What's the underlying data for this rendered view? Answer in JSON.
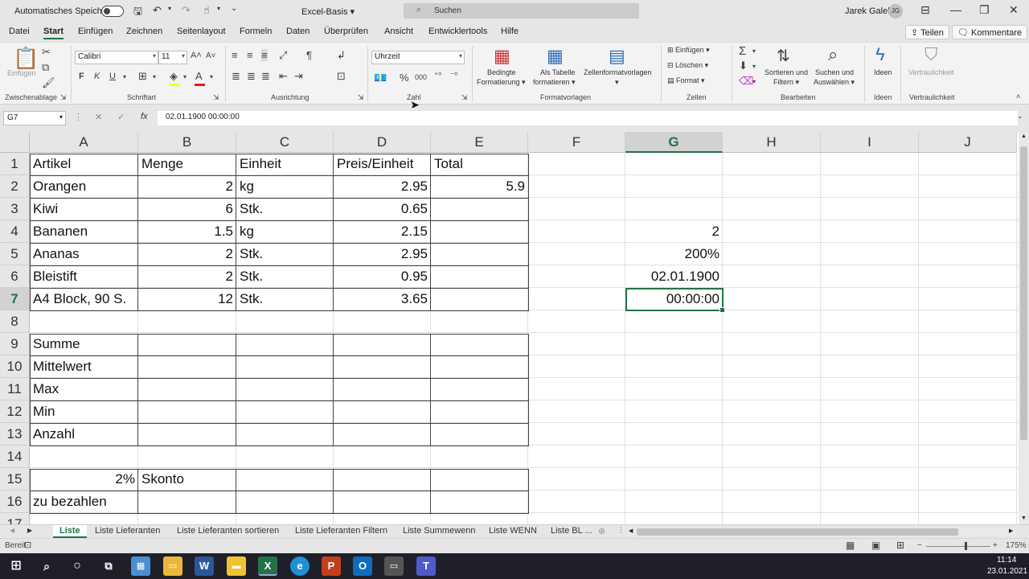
{
  "titlebar": {
    "autosave_label": "Automatisches Speichern",
    "file_name": "Excel-Basis",
    "search_placeholder": "Suchen",
    "user_name": "Jarek Galek",
    "user_initials": "JG"
  },
  "tabs": [
    "Datei",
    "Start",
    "Einfügen",
    "Zeichnen",
    "Seitenlayout",
    "Formeln",
    "Daten",
    "Überprüfen",
    "Ansicht",
    "Entwicklertools",
    "Hilfe"
  ],
  "active_tab": "Start",
  "share_label": "Teilen",
  "comments_label": "Kommentare",
  "ribbon": {
    "clipboard": {
      "paste_label": "Einfügen",
      "group": "Zwischenablage"
    },
    "font": {
      "name": "Calibri",
      "size": "11",
      "bold": "F",
      "italic": "K",
      "underline": "U",
      "group": "Schriftart"
    },
    "alignment": {
      "group": "Ausrichtung"
    },
    "number": {
      "format": "Uhrzeit",
      "percent": "%",
      "thousands": "000",
      "group": "Zahl"
    },
    "styles": {
      "conditional": "Bedingte",
      "conditional2": "Formatierung",
      "as_table": "Als Tabelle",
      "as_table2": "formatieren",
      "cell_styles": "Zellenformatvorlagen",
      "group": "Formatvorlagen"
    },
    "cells": {
      "insert": "Einfügen",
      "delete": "Löschen",
      "format": "Format",
      "group": "Zellen"
    },
    "editing": {
      "sort": "Sortieren und",
      "sort2": "Filtern",
      "find": "Suchen und",
      "find2": "Auswählen",
      "group": "Bearbeiten"
    },
    "ideas": {
      "label": "Ideen",
      "group": "Ideen"
    },
    "sensitivity": {
      "label": "Vertraulichkeit",
      "group": "Vertraulichkeit"
    }
  },
  "formula_bar": {
    "name_box": "G7",
    "fx": "fx",
    "formula": "02.01.1900  00:00:00"
  },
  "columns": [
    "A",
    "B",
    "C",
    "D",
    "E",
    "F",
    "G",
    "H",
    "I",
    "J"
  ],
  "rows": [
    "1",
    "2",
    "3",
    "4",
    "5",
    "6",
    "7",
    "8",
    "9",
    "10",
    "11",
    "12",
    "13",
    "14",
    "15",
    "16",
    "17"
  ],
  "cells": {
    "A1": "Artikel",
    "B1": "Menge",
    "C1": "Einheit",
    "D1": "Preis/Einheit",
    "E1": "Total",
    "A2": "Orangen",
    "B2": "2",
    "C2": "kg",
    "D2": "2.95",
    "E2": "5.9",
    "A3": "Kiwi",
    "B3": "6",
    "C3": "Stk.",
    "D3": "0.65",
    "A4": "Bananen",
    "B4": "1.5",
    "C4": "kg",
    "D4": "2.15",
    "G4": "2",
    "A5": "Ananas",
    "B5": "2",
    "C5": "Stk.",
    "D5": "2.95",
    "G5": "200%",
    "A6": "Bleistift",
    "B6": "2",
    "C6": "Stk.",
    "D6": "0.95",
    "G6": "02.01.1900",
    "A7": "A4 Block, 90 S.",
    "B7": "12",
    "C7": "Stk.",
    "D7": "3.65",
    "G7": "00:00:00",
    "A9": "Summe",
    "A10": "Mittelwert",
    "A11": "Max",
    "A12": "Min",
    "A13": "Anzahl",
    "A15": "2%",
    "B15": "Skonto",
    "A16": "zu bezahlen"
  },
  "sheet_tabs": [
    "Liste",
    "Liste Lieferanten",
    "Liste Lieferanten sortieren",
    "Liste Lieferanten Filtern",
    "Liste Summewenn",
    "Liste WENN",
    "Liste BL ..."
  ],
  "active_sheet": "Liste",
  "status": {
    "ready": "Bereit",
    "zoom": "175%"
  },
  "taskbar": {
    "time": "11:14",
    "date": "23.01.2021"
  },
  "colors": {
    "accent": "#217346",
    "taskbar": "#1f1f2a"
  }
}
